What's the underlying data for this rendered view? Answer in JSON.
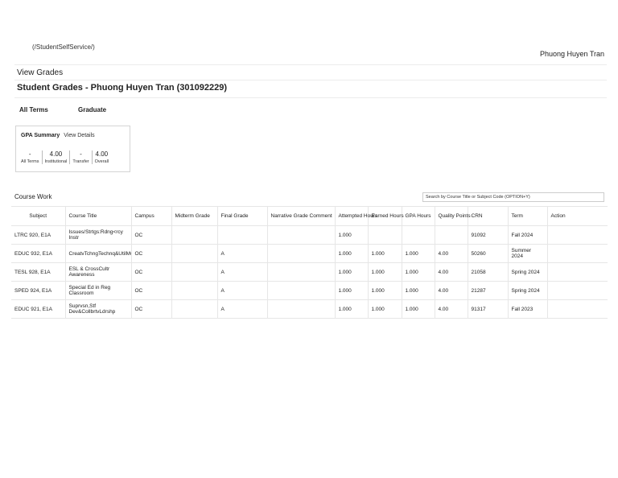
{
  "header": {
    "home_link": "(/StudentSelfService/)",
    "user_name": "Phuong Huyen Tran"
  },
  "breadcrumb": "View Grades",
  "page_title": "Student Grades - Phuong Huyen Tran (301092229)",
  "term_tabs": [
    "All Terms",
    "Graduate"
  ],
  "gpa_summary": {
    "title": "GPA Summary",
    "details_link": "View Details",
    "cells": [
      {
        "value": "-",
        "label": "All Terms"
      },
      {
        "value": "4.00",
        "label": "Institutional"
      },
      {
        "value": "-",
        "label": "Transfer"
      },
      {
        "value": "4.00",
        "label": "Overall"
      }
    ]
  },
  "course_work": {
    "title": "Course Work",
    "search_placeholder": "Search by Course Title or Subject Code (OPTION+Y)",
    "columns": [
      "Subject",
      "Course Title",
      "Campus",
      "Midterm Grade",
      "Final Grade",
      "Narrative Grade Comment",
      "Attempted Hours",
      "Earned Hours",
      "GPA Hours",
      "Quality Points",
      "CRN",
      "Term",
      "Action"
    ],
    "rows": [
      [
        "LTRC 920, E1A",
        "Issues/Strtgs:Rdng<rcy Instr",
        "OC",
        "",
        "",
        "",
        "1.000",
        "",
        "",
        "",
        "91092",
        "Fall 2024",
        ""
      ],
      [
        "EDUC 932, E1A",
        "CreatvTchngTechnq&UtilMultMed",
        "OC",
        "",
        "A",
        "",
        "1.000",
        "1.000",
        "1.000",
        "4.00",
        "50260",
        "Summer 2024",
        ""
      ],
      [
        "TESL 928, E1A",
        "ESL & CrossCultr Awareness",
        "OC",
        "",
        "A",
        "",
        "1.000",
        "1.000",
        "1.000",
        "4.00",
        "21058",
        "Spring 2024",
        ""
      ],
      [
        "SPED 924, E1A",
        "Special Ed in Reg Classroom",
        "OC",
        "",
        "A",
        "",
        "1.000",
        "1.000",
        "1.000",
        "4.00",
        "21287",
        "Spring 2024",
        ""
      ],
      [
        "EDUC 921, E1A",
        "Suprvsn,Stf Dev&CollbrtvLdrshp",
        "OC",
        "",
        "A",
        "",
        "1.000",
        "1.000",
        "1.000",
        "4.00",
        "91317",
        "Fall 2023",
        ""
      ]
    ]
  }
}
